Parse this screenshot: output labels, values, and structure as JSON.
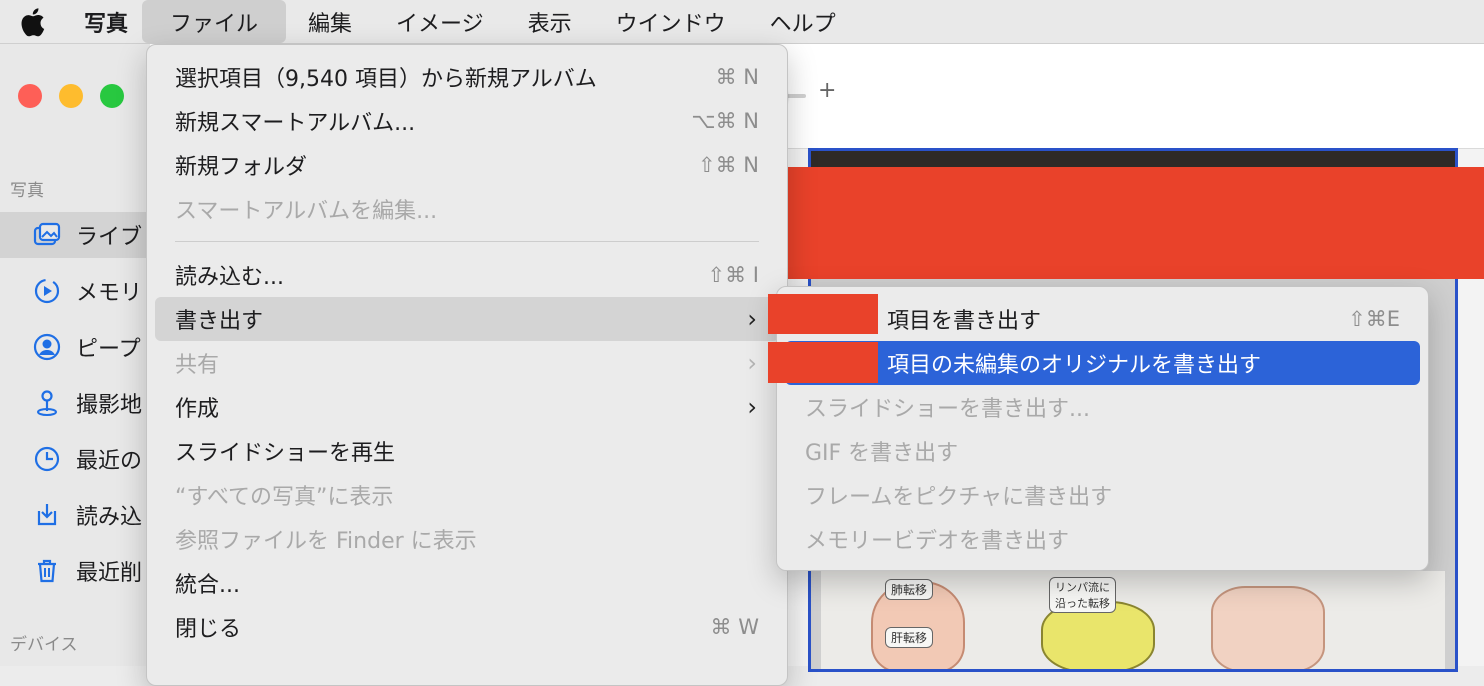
{
  "menubar": {
    "apple_icon": "apple-logo-icon",
    "items": [
      "写真",
      "ファイル",
      "編集",
      "イメージ",
      "表示",
      "ウインドウ",
      "ヘルプ"
    ]
  },
  "sidebar": {
    "section_photos": "写真",
    "section_devices": "デバイス",
    "items": [
      {
        "label": "ライブ",
        "icon": "library-icon"
      },
      {
        "label": "メモリ",
        "icon": "memories-icon"
      },
      {
        "label": "ピープ",
        "icon": "people-icon"
      },
      {
        "label": "撮影地",
        "icon": "places-icon"
      },
      {
        "label": "最近の",
        "icon": "recents-icon"
      },
      {
        "label": "読み込",
        "icon": "imports-icon"
      },
      {
        "label": "最近削",
        "icon": "trash-icon"
      }
    ]
  },
  "toolbar": {
    "zoom_minus": "−",
    "zoom_plus": "+",
    "zoom_level": 0.75
  },
  "photo": {
    "labels": [
      "肺転移",
      "肝転移",
      "リンパ流に\n沿った転移"
    ]
  },
  "file_menu": {
    "items": [
      {
        "label": "選択項目（9,540 項目）から新規アルバム",
        "shortcut": "⌘ N"
      },
      {
        "label": "新規スマートアルバム...",
        "shortcut": "⌥⌘ N"
      },
      {
        "label": "新規フォルダ",
        "shortcut": "⇧⌘ N"
      },
      {
        "label": "スマートアルバムを編集...",
        "shortcut": "",
        "disabled": true
      },
      {
        "label": "読み込む...",
        "shortcut": "⇧⌘ I"
      },
      {
        "label": "書き出す",
        "shortcut": "›",
        "submenu": true,
        "highlighted": true
      },
      {
        "label": "共有",
        "shortcut": "›",
        "submenu": true,
        "disabled": true
      },
      {
        "label": "作成",
        "shortcut": "›",
        "submenu": true
      },
      {
        "label": "スライドショーを再生",
        "shortcut": ""
      },
      {
        "label": "“すべての写真”に表示",
        "shortcut": "",
        "disabled": true
      },
      {
        "label": "参照ファイルを Finder に表示",
        "shortcut": "",
        "disabled": true
      },
      {
        "label": "統合...",
        "shortcut": ""
      },
      {
        "label": "閉じる",
        "shortcut": "⌘ W"
      }
    ]
  },
  "export_submenu": {
    "items": [
      {
        "label": "項目を書き出す",
        "shortcut": "⇧⌘E"
      },
      {
        "label": "項目の未編集のオリジナルを書き出す",
        "shortcut": "",
        "selected": true
      },
      {
        "label": "スライドショーを書き出す...",
        "shortcut": "",
        "disabled": true
      },
      {
        "label": "GIF を書き出す",
        "shortcut": "",
        "disabled": true
      },
      {
        "label": "フレームをピクチャに書き出す",
        "shortcut": "",
        "disabled": true
      },
      {
        "label": "メモリービデオを書き出す",
        "shortcut": "",
        "disabled": true
      }
    ]
  },
  "colors": {
    "selection": "#2c63d8",
    "redaction": "#e9422a",
    "photo_border": "#2a52c9"
  }
}
